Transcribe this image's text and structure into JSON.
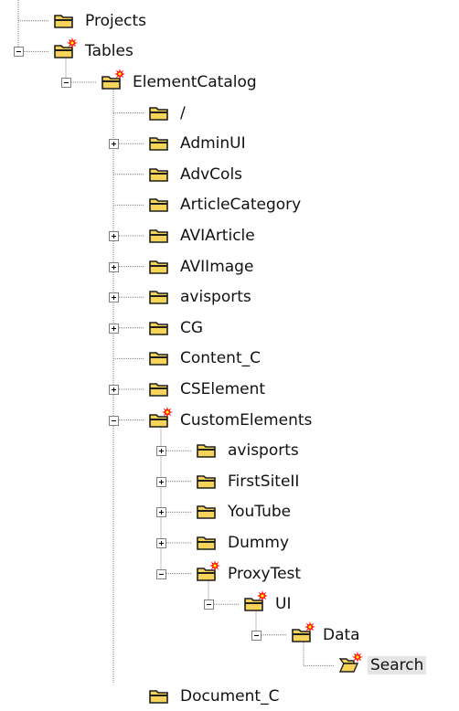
{
  "tree": {
    "nodes": [
      {
        "label": "Projects",
        "level": 0,
        "icon": "folder-icon",
        "expander": "none"
      },
      {
        "label": "Tables",
        "level": 0,
        "icon": "folder-new-icon",
        "expander": "minus"
      },
      {
        "label": "ElementCatalog",
        "level": 1,
        "icon": "folder-new-icon",
        "expander": "minus"
      },
      {
        "label": "/",
        "level": 2,
        "icon": "folder-icon",
        "expander": "none"
      },
      {
        "label": "AdminUI",
        "level": 2,
        "icon": "folder-icon",
        "expander": "plus"
      },
      {
        "label": "AdvCols",
        "level": 2,
        "icon": "folder-icon",
        "expander": "none"
      },
      {
        "label": "ArticleCategory",
        "level": 2,
        "icon": "folder-icon",
        "expander": "none"
      },
      {
        "label": "AVIArticle",
        "level": 2,
        "icon": "folder-icon",
        "expander": "plus"
      },
      {
        "label": "AVIImage",
        "level": 2,
        "icon": "folder-icon",
        "expander": "plus"
      },
      {
        "label": "avisports",
        "level": 2,
        "icon": "folder-icon",
        "expander": "plus"
      },
      {
        "label": "CG",
        "level": 2,
        "icon": "folder-icon",
        "expander": "plus"
      },
      {
        "label": "Content_C",
        "level": 2,
        "icon": "folder-icon",
        "expander": "none"
      },
      {
        "label": "CSElement",
        "level": 2,
        "icon": "folder-icon",
        "expander": "plus"
      },
      {
        "label": "CustomElements",
        "level": 2,
        "icon": "folder-new-icon",
        "expander": "minus"
      },
      {
        "label": "avisports",
        "level": 3,
        "icon": "folder-icon",
        "expander": "plus"
      },
      {
        "label": "FirstSiteII",
        "level": 3,
        "icon": "folder-icon",
        "expander": "plus"
      },
      {
        "label": "YouTube",
        "level": 3,
        "icon": "folder-icon",
        "expander": "plus"
      },
      {
        "label": "Dummy",
        "level": 3,
        "icon": "folder-icon",
        "expander": "plus"
      },
      {
        "label": "ProxyTest",
        "level": 3,
        "icon": "folder-new-icon",
        "expander": "minus"
      },
      {
        "label": "UI",
        "level": 4,
        "icon": "folder-new-icon",
        "expander": "minus"
      },
      {
        "label": "Data",
        "level": 5,
        "icon": "folder-new-icon",
        "expander": "minus"
      },
      {
        "label": "Search",
        "level": 6,
        "icon": "folder-open-new-icon",
        "expander": "none",
        "selected": true
      },
      {
        "label": "Document_C",
        "level": 2,
        "icon": "folder-icon",
        "expander": "none"
      }
    ]
  },
  "colors": {
    "folder_fill": "#f6d45a",
    "folder_dark": "#1e1e1e",
    "burst": "#ff0000",
    "burst_core": "#ffff00",
    "line": "#808080",
    "selection": "#e5e5e5"
  }
}
